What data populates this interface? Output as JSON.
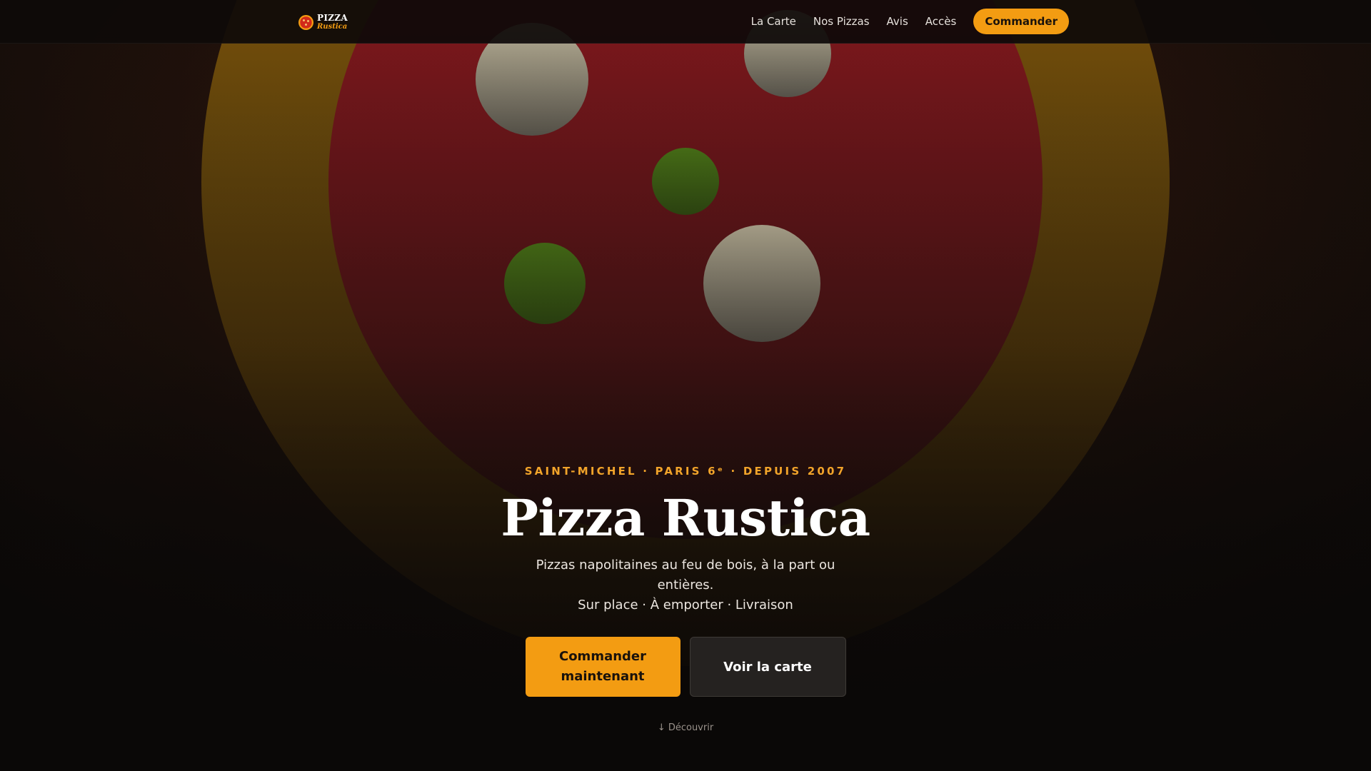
{
  "colors": {
    "accent": "#f39c12",
    "background": "#0a0807",
    "crust": "#b87b0a",
    "sauce": "#a31c22",
    "mozzarella": "#cfc7b0",
    "basil": "#4f7a1a"
  },
  "nav": {
    "logo_top": "PIZZA",
    "logo_bottom": "Rustica",
    "logo_icon": "pizza-icon",
    "links": [
      "La Carte",
      "Nos Pizzas",
      "Avis",
      "Accès"
    ],
    "cta_label": "Commander"
  },
  "hero": {
    "eyebrow": "SAINT-MICHEL · PARIS 6ᵉ · DEPUIS 2007",
    "title": "Pizza Rustica",
    "subtitle_line1": "Pizzas napolitaines au feu de bois, à la part ou entières.",
    "subtitle_line2": "Sur place · À emporter · Livraison",
    "primary_button": "Commander maintenant",
    "secondary_button": "Voir la carte",
    "scroll_hint": "↓ Découvrir"
  }
}
